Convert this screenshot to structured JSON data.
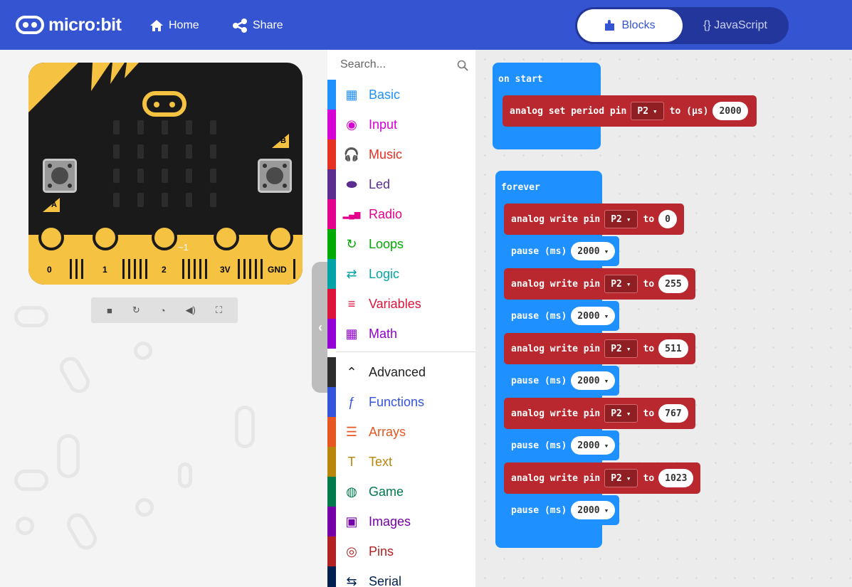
{
  "header": {
    "logo_text": "micro:bit",
    "home_label": "Home",
    "share_label": "Share",
    "blocks_label": "Blocks",
    "javascript_label": "{} JavaScript",
    "colors": {
      "bar": "#3454D1",
      "toggle": "#23369C"
    }
  },
  "simulator": {
    "button_a": "A",
    "button_b": "B",
    "pins": [
      "0",
      "1",
      "2",
      "3V",
      "GND"
    ],
    "pin_marker": "~1",
    "controls": [
      "stop-icon",
      "restart-icon",
      "slowmo-icon",
      "mute-icon",
      "fullscreen-icon"
    ]
  },
  "toolbox": {
    "search_placeholder": "Search...",
    "categories": [
      {
        "label": "Basic",
        "color": "#1E90FF",
        "icon": "grid-icon"
      },
      {
        "label": "Input",
        "color": "#D400D4",
        "icon": "radio-button-icon"
      },
      {
        "label": "Music",
        "color": "#E63022",
        "icon": "headphones-icon"
      },
      {
        "label": "Led",
        "color": "#5C2D91",
        "icon": "toggle-icon"
      },
      {
        "label": "Radio",
        "color": "#E3008C",
        "icon": "signal-icon"
      },
      {
        "label": "Loops",
        "color": "#00AA00",
        "icon": "loop-icon"
      },
      {
        "label": "Logic",
        "color": "#00A4A6",
        "icon": "shuffle-icon"
      },
      {
        "label": "Variables",
        "color": "#DC143C",
        "icon": "lines-icon"
      },
      {
        "label": "Math",
        "color": "#9400D3",
        "icon": "calculator-icon"
      }
    ],
    "advanced": [
      {
        "label": "Advanced",
        "color": "#2D2D2D",
        "icon": "chevron-up-icon"
      },
      {
        "label": "Functions",
        "color": "#3455DB",
        "icon": "function-icon"
      },
      {
        "label": "Arrays",
        "color": "#E65722",
        "icon": "list-icon"
      },
      {
        "label": "Text",
        "color": "#B8860B",
        "icon": "text-icon"
      },
      {
        "label": "Game",
        "color": "#007A4B",
        "icon": "gamepad-icon"
      },
      {
        "label": "Images",
        "color": "#7600A8",
        "icon": "image-icon"
      },
      {
        "label": "Pins",
        "color": "#B22222",
        "icon": "target-icon"
      },
      {
        "label": "Serial",
        "color": "#002050",
        "icon": "usb-icon"
      }
    ]
  },
  "workspace": {
    "on_start": {
      "label": "on start",
      "block_text": "analog set period pin",
      "pin": "P2",
      "to_text": "to (µs)",
      "value": "2000"
    },
    "forever": {
      "label": "forever",
      "write_text": "analog write pin",
      "pause_text": "pause (ms)",
      "pin": "P2",
      "to_text": "to",
      "steps": [
        {
          "value": "0",
          "pause": "2000"
        },
        {
          "value": "255",
          "pause": "2000"
        },
        {
          "value": "511",
          "pause": "2000"
        },
        {
          "value": "767",
          "pause": "2000"
        },
        {
          "value": "1023",
          "pause": "2000"
        }
      ]
    }
  }
}
